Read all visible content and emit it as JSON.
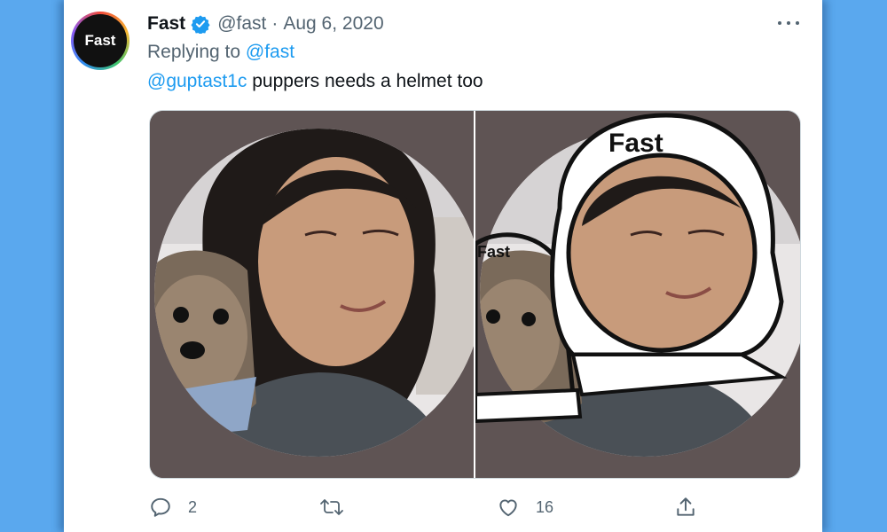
{
  "tweet": {
    "avatar_text": "Fast",
    "author_name": "Fast",
    "handle": "@fast",
    "separator": "·",
    "date": "Aug 6, 2020",
    "replying_prefix": "Replying to",
    "replying_handle": "@fast",
    "mention": "@guptast1c",
    "text": "puppers needs a helmet too",
    "helmet_label_big": "Fast",
    "helmet_label_small": "Fast"
  },
  "actions": {
    "reply_count": "2",
    "like_count": "16"
  },
  "icons": [
    "verified-badge-icon",
    "more-icon",
    "reply-icon",
    "retweet-icon",
    "like-icon",
    "share-icon"
  ],
  "colors": {
    "background": "#5aa8ee",
    "card": "#ffffff",
    "link": "#1d9bf0",
    "text_primary": "#0f1419",
    "text_secondary": "#536471",
    "photo_backdrop": "#5f5454"
  }
}
